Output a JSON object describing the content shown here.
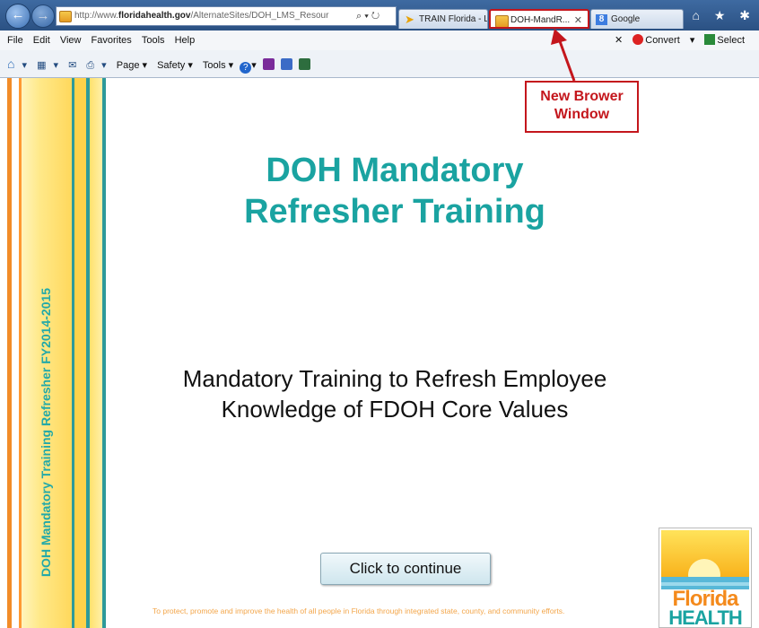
{
  "browser": {
    "nav": {
      "back_icon": "←",
      "forward_icon": "→"
    },
    "address": {
      "url_prefix": "http://www.",
      "url_domain": "floridahealth.gov",
      "url_path": "/AlternateSites/DOH_LMS_Resour",
      "controls": "⌕ ▾ ↻"
    },
    "tabs": [
      {
        "label": "TRAIN Florida - L..."
      },
      {
        "label": "DOH-MandR...",
        "close": "✕"
      },
      {
        "label": "Google"
      }
    ],
    "right_icons": "⌂ ★ ✱",
    "menu": [
      "File",
      "Edit",
      "View",
      "Favorites",
      "Tools",
      "Help"
    ],
    "menu_right": {
      "close": "✕",
      "convert": "Convert",
      "select": "Select"
    },
    "command": {
      "page": "Page",
      "safety": "Safety",
      "tools": "Tools"
    }
  },
  "page": {
    "vertical_title": "DOH Mandatory Training  Refresher FY2014-2015",
    "title_line1": "DOH Mandatory",
    "title_line2": "Refresher Training",
    "subtitle_line1": "Mandatory Training to Refresh Employee",
    "subtitle_line2": "Knowledge of FDOH Core Values",
    "continue_label": "Click to continue",
    "tagline": "To protect, promote and improve the health of all people in Florida through integrated state, county, and community efforts.",
    "logo": {
      "word1": "Florida",
      "word2": "HEALTH"
    }
  },
  "annotation": {
    "line1": "New Brower",
    "line2": "Window"
  },
  "colors": {
    "teal": "#1aa3a1",
    "callout_red": "#c4161c",
    "orange": "#f28c28"
  }
}
